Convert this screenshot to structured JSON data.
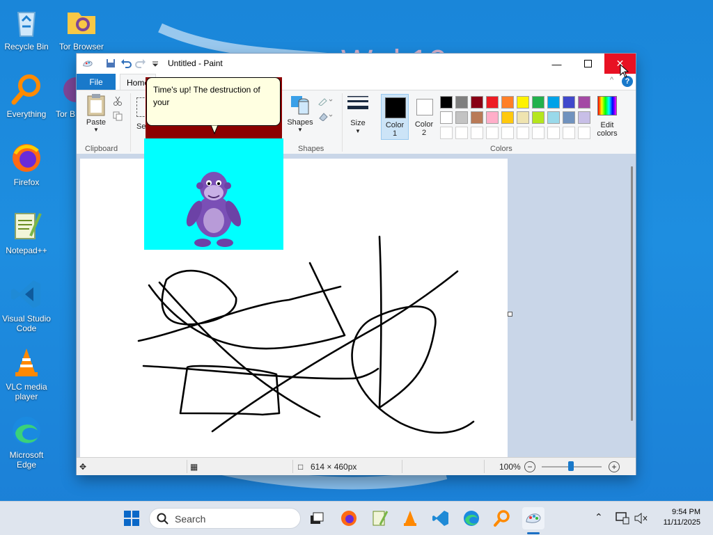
{
  "desktop": {
    "icons": [
      {
        "label": "Recycle Bin"
      },
      {
        "label": "Tor Browser"
      },
      {
        "label": "Everything"
      },
      {
        "label": "Tor B"
      },
      {
        "label": "Firefox"
      },
      {
        "label": "Notepad++"
      },
      {
        "label": "Visual Studio Code"
      },
      {
        "label": "VLC media player"
      },
      {
        "label": "Microsoft Edge"
      }
    ]
  },
  "paint": {
    "title": "Untitled - Paint",
    "tabs": {
      "file": "File",
      "home": "Home"
    },
    "ribbon": {
      "clipboard": {
        "paste": "Paste",
        "group": "Clipboard",
        "select_partial": "Se"
      },
      "shapes": {
        "label": "Shapes",
        "group": "Shapes"
      },
      "size": "Size",
      "color1": [
        "Color",
        "1"
      ],
      "color2": [
        "Color",
        "2"
      ],
      "edit_colors": [
        "Edit",
        "colors"
      ],
      "colors_group": "Colors",
      "palette_row1": [
        "#000000",
        "#7f7f7f",
        "#880015",
        "#ed1c24",
        "#ff7f27",
        "#fff200",
        "#22b14c",
        "#00a2e8",
        "#3f48cc",
        "#a349a4"
      ],
      "palette_row2": [
        "#ffffff",
        "#c3c3c3",
        "#b97a57",
        "#ffaec9",
        "#ffc90e",
        "#efe4b0",
        "#b5e61d",
        "#99d9ea",
        "#7092be",
        "#c8bfe7"
      ],
      "color1_value": "#000000",
      "color2_value": "#ffffff"
    },
    "status": {
      "dimensions": "614 × 460px",
      "zoom": "100%"
    }
  },
  "bonzi": {
    "message": "Time's up! The destruction of your"
  },
  "taskbar": {
    "search_placeholder": "Search",
    "time": "9:54 PM",
    "date": "11/11/2025"
  }
}
